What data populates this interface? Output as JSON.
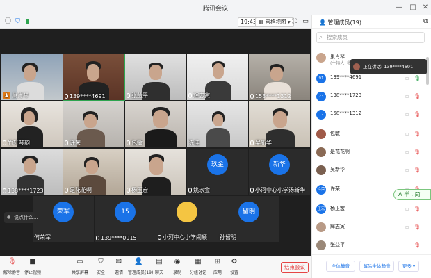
{
  "window": {
    "title": "腾讯会议"
  },
  "toolbar": {
    "time": "19:43",
    "view_label": "宫格视图"
  },
  "tiles": [
    {
      "name": "巢肖琴",
      "host": true
    },
    {
      "name": "139****4691",
      "active": true
    },
    {
      "name": "张益平"
    },
    {
      "name": "辉志寅"
    },
    {
      "name": "158****1312"
    },
    {
      "name": "竹轩琴韵"
    },
    {
      "name": "许荣"
    },
    {
      "name": "包敏"
    },
    {
      "name": "陈佳"
    },
    {
      "name": "吴新华"
    },
    {
      "name": "138****1723"
    },
    {
      "name": "是花花啊"
    },
    {
      "name": "杨玉宏"
    },
    {
      "name": "姚玖金",
      "avatar": "玖金"
    },
    {
      "name": "小河中心小学汤新华",
      "avatar": "新华"
    },
    {
      "name": "何荣军",
      "avatar": "荣军"
    },
    {
      "name": "139****0915",
      "avatar": "15"
    },
    {
      "name": "小河中心小学闹颖"
    },
    {
      "name": "孙留明",
      "avatar": "留明"
    }
  ],
  "subtitle": "说点什么...",
  "bottom": {
    "mute": "解除静音",
    "video": "停止视频",
    "share": "共享屏幕",
    "security": "安全",
    "invite": "邀请",
    "manage": "管理成员(19)",
    "chat": "聊天",
    "record": "录制",
    "breakout": "分组讨论",
    "apps": "应用",
    "settings": "设置",
    "end": "结束会议"
  },
  "panel": {
    "title": "管理成员(19)",
    "search_placeholder": "搜索成员",
    "members": [
      {
        "name": "巢肖琴",
        "sub": "(主持人, 我)",
        "avatar": ""
      },
      {
        "name": "139****4691",
        "avatar": "91"
      },
      {
        "name": "138****1723",
        "avatar": "23"
      },
      {
        "name": "158****1312",
        "avatar": "12"
      },
      {
        "name": "包敏",
        "avatar": ""
      },
      {
        "name": "是花花啊",
        "avatar": ""
      },
      {
        "name": "吴新华",
        "avatar": ""
      },
      {
        "name": "许荣",
        "avatar": "许荣"
      },
      {
        "name": "杨玉宏",
        "avatar": "玉宏"
      },
      {
        "name": "辉志寅",
        "avatar": ""
      },
      {
        "name": "张益平",
        "avatar": ""
      }
    ],
    "speaking": "正在讲话: 139****4691",
    "float_chip": "A 半 , 简",
    "mute_all": "全体静音",
    "unmute_all": "解除全体静音",
    "more": "更多 ▾"
  },
  "colors": {
    "accent": "#1a73e8",
    "danger": "#e54545",
    "grid_bg": "#1f1f1f"
  }
}
